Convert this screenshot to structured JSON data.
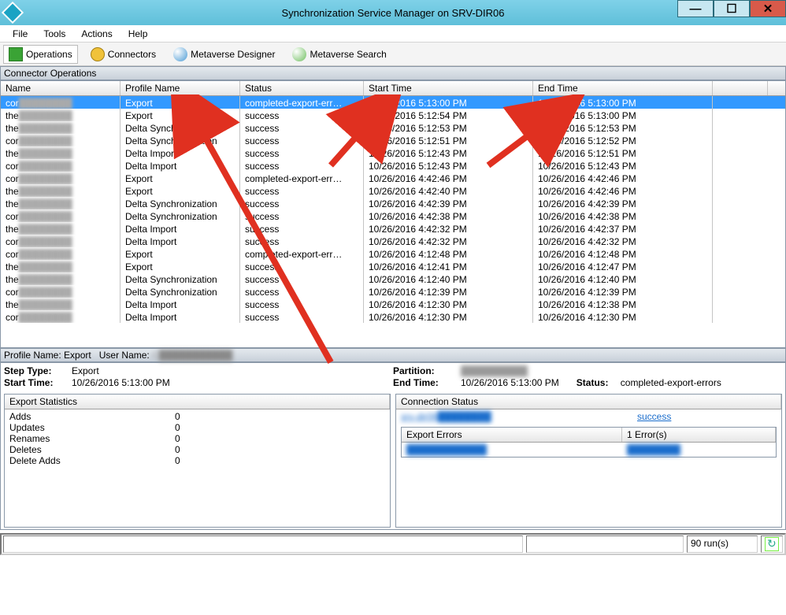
{
  "window": {
    "title": "Synchronization Service Manager on SRV-DIR06"
  },
  "menu": {
    "file": "File",
    "tools": "Tools",
    "actions": "Actions",
    "help": "Help"
  },
  "toolbar": {
    "operations": "Operations",
    "connectors": "Connectors",
    "mv_designer": "Metaverse Designer",
    "mv_search": "Metaverse Search"
  },
  "section": {
    "connector_ops": "Connector Operations"
  },
  "columns": {
    "name": "Name",
    "profile": "Profile Name",
    "status": "Status",
    "start": "Start Time",
    "end": "End Time"
  },
  "rows": [
    {
      "name": "cor…",
      "profile": "Export",
      "status": "completed-export-err…",
      "start": "10/26/2016 5:13:00 PM",
      "end": "10/26/2016 5:13:00 PM",
      "sel": true
    },
    {
      "name": "the…",
      "profile": "Export",
      "status": "success",
      "start": "10/26/2016 5:12:54 PM",
      "end": "10/26/2016 5:13:00 PM"
    },
    {
      "name": "the…",
      "profile": "Delta Synchronization",
      "status": "success",
      "start": "10/26/2016 5:12:53 PM",
      "end": "10/26/2016 5:12:53 PM"
    },
    {
      "name": "cor…",
      "profile": "Delta Synchronization",
      "status": "success",
      "start": "10/26/2016 5:12:51 PM",
      "end": "10/26/2016 5:12:52 PM"
    },
    {
      "name": "the…",
      "profile": "Delta Import",
      "status": "success",
      "start": "10/26/2016 5:12:43 PM",
      "end": "10/26/2016 5:12:51 PM"
    },
    {
      "name": "cor…",
      "profile": "Delta Import",
      "status": "success",
      "start": "10/26/2016 5:12:43 PM",
      "end": "10/26/2016 5:12:43 PM"
    },
    {
      "name": "cor…",
      "profile": "Export",
      "status": "completed-export-err…",
      "start": "10/26/2016 4:42:46 PM",
      "end": "10/26/2016 4:42:46 PM"
    },
    {
      "name": "the…",
      "profile": "Export",
      "status": "success",
      "start": "10/26/2016 4:42:40 PM",
      "end": "10/26/2016 4:42:46 PM"
    },
    {
      "name": "the…",
      "profile": "Delta Synchronization",
      "status": "success",
      "start": "10/26/2016 4:42:39 PM",
      "end": "10/26/2016 4:42:39 PM"
    },
    {
      "name": "cor…",
      "profile": "Delta Synchronization",
      "status": "success",
      "start": "10/26/2016 4:42:38 PM",
      "end": "10/26/2016 4:42:38 PM"
    },
    {
      "name": "the…",
      "profile": "Delta Import",
      "status": "success",
      "start": "10/26/2016 4:42:32 PM",
      "end": "10/26/2016 4:42:37 PM"
    },
    {
      "name": "cor…",
      "profile": "Delta Import",
      "status": "success",
      "start": "10/26/2016 4:42:32 PM",
      "end": "10/26/2016 4:42:32 PM"
    },
    {
      "name": "cor…",
      "profile": "Export",
      "status": "completed-export-err…",
      "start": "10/26/2016 4:12:48 PM",
      "end": "10/26/2016 4:12:48 PM"
    },
    {
      "name": "the…",
      "profile": "Export",
      "status": "success",
      "start": "10/26/2016 4:12:41 PM",
      "end": "10/26/2016 4:12:47 PM"
    },
    {
      "name": "the…",
      "profile": "Delta Synchronization",
      "status": "success",
      "start": "10/26/2016 4:12:40 PM",
      "end": "10/26/2016 4:12:40 PM"
    },
    {
      "name": "cor…",
      "profile": "Delta Synchronization",
      "status": "success",
      "start": "10/26/2016 4:12:39 PM",
      "end": "10/26/2016 4:12:39 PM"
    },
    {
      "name": "the…",
      "profile": "Delta Import",
      "status": "success",
      "start": "10/26/2016 4:12:30 PM",
      "end": "10/26/2016 4:12:38 PM"
    },
    {
      "name": "corp…",
      "profile": "Delta Import",
      "status": "success",
      "start": "10/26/2016 4:12:30 PM",
      "end": "10/26/2016 4:12:30 PM"
    }
  ],
  "detailhdr": {
    "profile_lbl": "Profile Name:",
    "profile_val": "Export",
    "user_lbl": "User Name:",
    "user_val": "C███████████"
  },
  "detail": {
    "step_lbl": "Step Type:",
    "step_val": "Export",
    "start_lbl": "Start Time:",
    "start_val": "10/26/2016 5:13:00 PM",
    "part_lbl": "Partition:",
    "part_val": "██████████",
    "end_lbl": "End Time:",
    "end_val": "10/26/2016 5:13:00 PM",
    "status_lbl": "Status:",
    "status_val": "completed-export-errors"
  },
  "export_stats": {
    "header": "Export Statistics",
    "rows": [
      {
        "l": "Adds",
        "v": "0"
      },
      {
        "l": "Updates",
        "v": "0"
      },
      {
        "l": "Renames",
        "v": "0"
      },
      {
        "l": "Deletes",
        "v": "0"
      },
      {
        "l": "Delete Adds",
        "v": "0"
      }
    ]
  },
  "conn_status": {
    "header": "Connection Status",
    "server": "srv-dir06████████",
    "state": "success"
  },
  "export_errors": {
    "header": "Export Errors",
    "count": "1 Error(s)",
    "item": "████████████",
    "reason": "████████"
  },
  "statusbar": {
    "runs": "90 run(s)"
  }
}
